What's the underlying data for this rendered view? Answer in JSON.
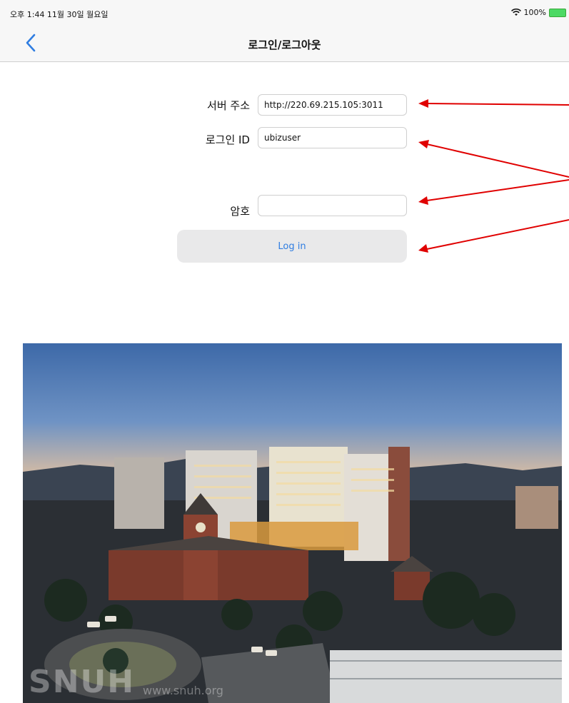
{
  "status_bar": {
    "time_date": "오후 1:44  11월 30일 월요일",
    "battery": "100%"
  },
  "nav": {
    "title": "로그인/로그아웃",
    "back_icon": "chevron-left-icon"
  },
  "form": {
    "server_label": "서버 주소",
    "server_value": "http://220.69.215.105:3011",
    "login_id_label": "로그인 ID",
    "login_id_value": "ubizuser",
    "password_label": "암호",
    "password_value": "",
    "login_button": "Log in"
  },
  "photo": {
    "watermark": "SNUH",
    "watermark_url": "www.snuh.org"
  },
  "colors": {
    "accent": "#2f7de1",
    "annotation_arrow": "#e00000",
    "button_bg": "#e9e9ea"
  }
}
